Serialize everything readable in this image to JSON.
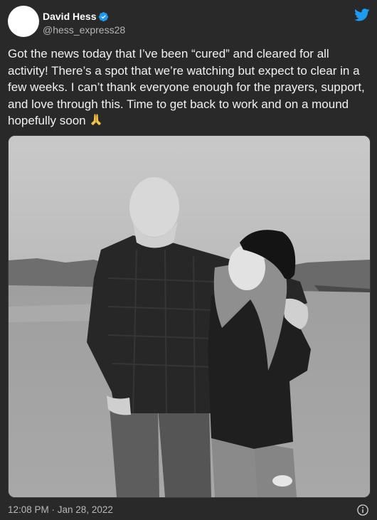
{
  "author": {
    "display_name": "David Hess",
    "handle": "@hess_express28",
    "verified": true,
    "avatar_icon": "avatar-placeholder"
  },
  "brand": {
    "logo_icon": "twitter-bird-icon",
    "accent_color": "#1d9bf0"
  },
  "tweet": {
    "text": "Got the news today that I’ve been “cured” and cleared for all activity! There’s a spot that we’re watching but expect to clear in a few weeks. I can’t thank everyone enough for the prayers, support, and love through this. Time to get back to work and on a mound hopefully soon ",
    "emoji_icon": "folded-hands-emoji",
    "media_alt": ""
  },
  "footer": {
    "timestamp": "12:08 PM · Jan 28, 2022",
    "info_icon": "info-icon"
  }
}
